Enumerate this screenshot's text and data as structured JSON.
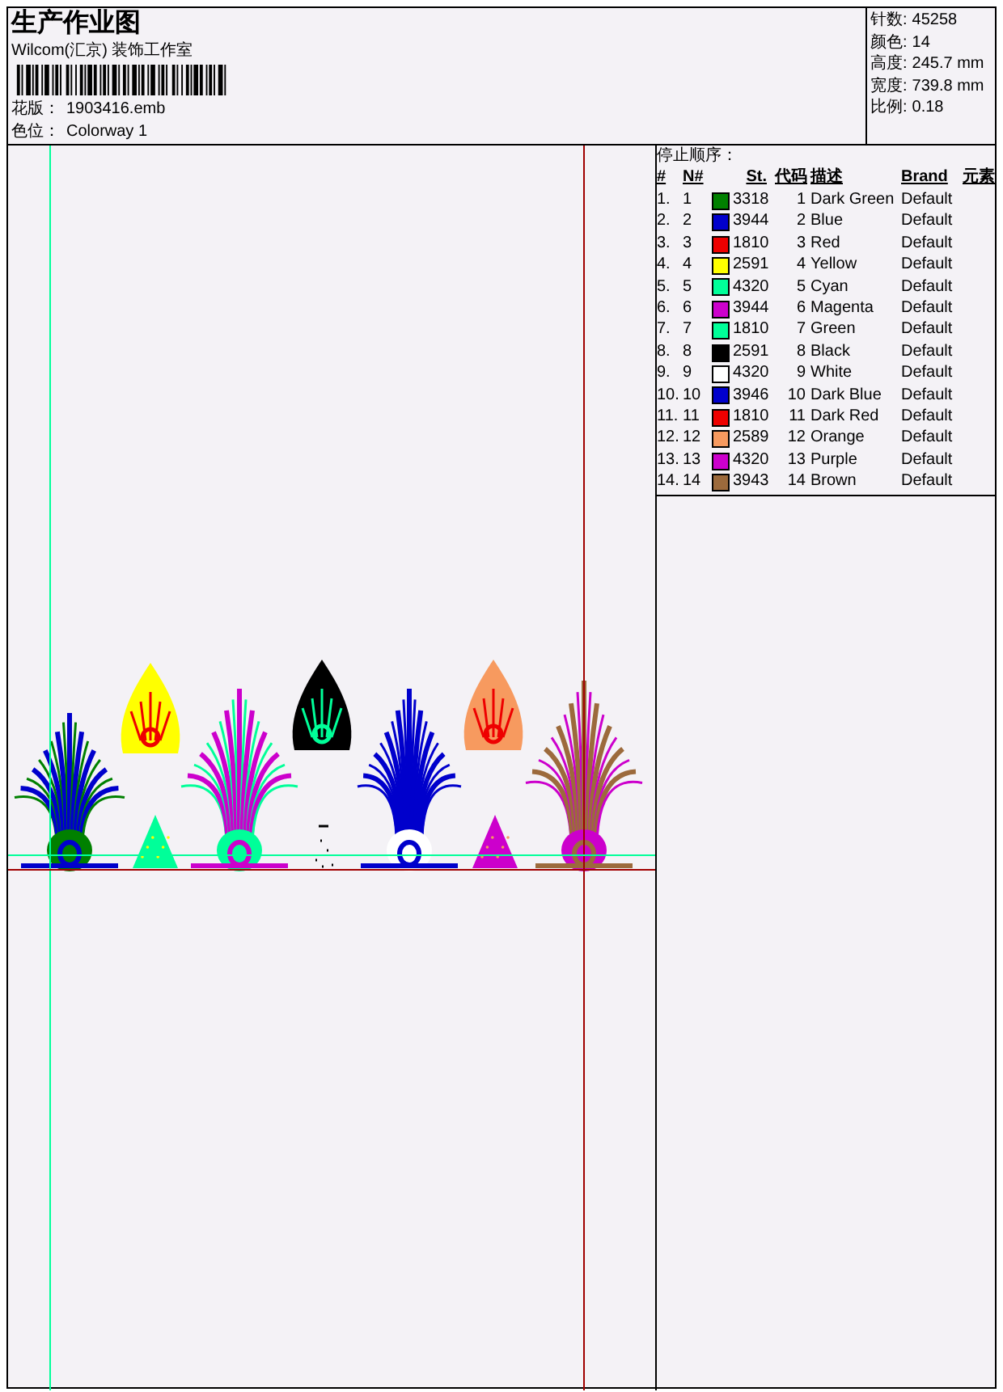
{
  "document": {
    "title": "生产作业图",
    "studio": "Wilcom(汇京) 装饰工作室",
    "design_file": {
      "label": "花版：",
      "value": "1903416.emb"
    },
    "colorway": {
      "label": "色位：",
      "value": "Colorway 1"
    }
  },
  "summary": [
    {
      "label": "针数:",
      "value": "45258"
    },
    {
      "label": "颜色:",
      "value": "14"
    },
    {
      "label": "高度:",
      "value": "245.7 mm"
    },
    {
      "label": "宽度:",
      "value": "739.8 mm"
    },
    {
      "label": "比例:",
      "value": "0.18"
    }
  ],
  "stop_sequence": {
    "title": "停止顺序：",
    "columns": [
      "#",
      "N#",
      "St.",
      "代码",
      "描述",
      "Brand",
      "元素"
    ],
    "rows": [
      {
        "index": "1.",
        "needle": "1",
        "color": "#008000",
        "stitches": "3318",
        "code": "1",
        "description": "Dark Green",
        "brand": "Default"
      },
      {
        "index": "2.",
        "needle": "2",
        "color": "#0000cc",
        "stitches": "3944",
        "code": "2",
        "description": "Blue",
        "brand": "Default"
      },
      {
        "index": "3.",
        "needle": "3",
        "color": "#ee0000",
        "stitches": "1810",
        "code": "3",
        "description": "Red",
        "brand": "Default"
      },
      {
        "index": "4.",
        "needle": "4",
        "color": "#ffff00",
        "stitches": "2591",
        "code": "4",
        "description": "Yellow",
        "brand": "Default"
      },
      {
        "index": "5.",
        "needle": "5",
        "color": "#00ff99",
        "stitches": "4320",
        "code": "5",
        "description": "Cyan",
        "brand": "Default"
      },
      {
        "index": "6.",
        "needle": "6",
        "color": "#cc00cc",
        "stitches": "3944",
        "code": "6",
        "description": "Magenta",
        "brand": "Default"
      },
      {
        "index": "7.",
        "needle": "7",
        "color": "#00ff99",
        "stitches": "1810",
        "code": "7",
        "description": "Green",
        "brand": "Default"
      },
      {
        "index": "8.",
        "needle": "8",
        "color": "#000000",
        "stitches": "2591",
        "code": "8",
        "description": "Black",
        "brand": "Default"
      },
      {
        "index": "9.",
        "needle": "9",
        "color": "#ffffff",
        "stitches": "4320",
        "code": "9",
        "description": "White",
        "brand": "Default"
      },
      {
        "index": "10.",
        "needle": "10",
        "color": "#0000cc",
        "stitches": "3946",
        "code": "10",
        "description": "Dark Blue",
        "brand": "Default"
      },
      {
        "index": "11.",
        "needle": "11",
        "color": "#ee0000",
        "stitches": "1810",
        "code": "11",
        "description": "Dark Red",
        "brand": "Default"
      },
      {
        "index": "12.",
        "needle": "12",
        "color": "#f79a5f",
        "stitches": "2589",
        "code": "12",
        "description": "Orange",
        "brand": "Default"
      },
      {
        "index": "13.",
        "needle": "13",
        "color": "#cc00cc",
        "stitches": "4320",
        "code": "13",
        "description": "Purple",
        "brand": "Default"
      },
      {
        "index": "14.",
        "needle": "14",
        "color": "#9c6a3c",
        "stitches": "3943",
        "code": "14",
        "description": "Brown",
        "brand": "Default"
      }
    ]
  }
}
